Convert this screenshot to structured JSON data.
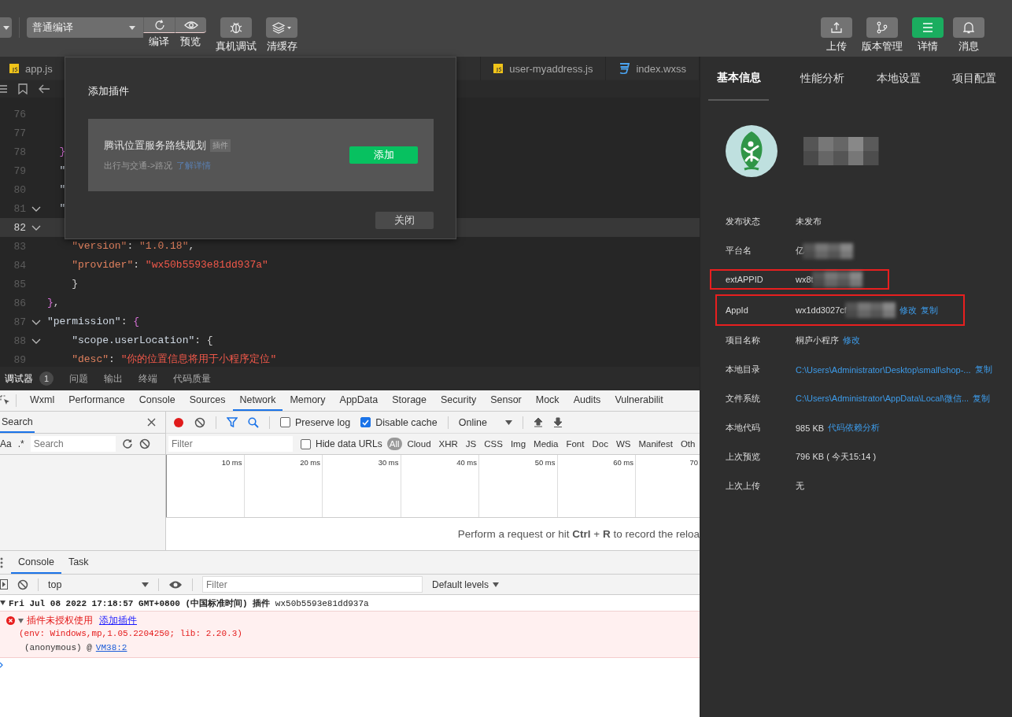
{
  "toolbar": {
    "left": [
      {
        "kind": "dropdown",
        "text": "普通编译"
      },
      {
        "kind": "group-button",
        "label": "编译"
      },
      {
        "kind": "group-button",
        "label": "预览"
      },
      {
        "kind": "button",
        "label": "真机调试"
      },
      {
        "kind": "menu-button",
        "label": "清缓存"
      }
    ],
    "right": [
      {
        "label": "上传",
        "selected": false
      },
      {
        "label": "版本管理",
        "selected": false
      },
      {
        "label": "详情",
        "selected": true
      },
      {
        "label": "消息",
        "selected": false
      }
    ]
  },
  "editor_tabs": [
    {
      "name": "app.js",
      "kind": "js",
      "selected": false
    },
    {
      "name": "user-myaddress.js",
      "kind": "js",
      "selected": false
    },
    {
      "name": "index.wxss",
      "kind": "wxss",
      "selected": false
    }
  ],
  "code": {
    "lines": [
      {
        "number": "76",
        "foldable": false,
        "current": false
      },
      {
        "number": "77",
        "foldable": false,
        "current": false
      },
      {
        "number": "78",
        "foldable": false,
        "current": false,
        "tokens": [
          {
            "kind": "brace",
            "text": "  }"
          }
        ]
      },
      {
        "number": "79",
        "foldable": false,
        "current": false,
        "tokens": [
          {
            "kind": "key",
            "text": "  \""
          }
        ]
      },
      {
        "number": "80",
        "foldable": false,
        "current": false,
        "tokens": [
          {
            "kind": "key",
            "text": "  \""
          }
        ]
      },
      {
        "number": "81",
        "foldable": true,
        "current": false,
        "tokens": [
          {
            "kind": "key",
            "text": "  \""
          }
        ]
      },
      {
        "number": "82",
        "foldable": true,
        "current": true
      },
      {
        "number": "83",
        "foldable": false,
        "current": false,
        "tokens": [
          {
            "kind": "attr",
            "text": "    \"version\""
          },
          {
            "kind": "punct",
            "text": ": "
          },
          {
            "kind": "attr",
            "text": "\"1.0.18\""
          },
          {
            "kind": "punct",
            "text": ","
          }
        ]
      },
      {
        "number": "84",
        "foldable": false,
        "current": false,
        "tokens": [
          {
            "kind": "attr",
            "text": "    \"provider\""
          },
          {
            "kind": "punct",
            "text": ": "
          },
          {
            "kind": "string",
            "text": "\"wx50b5593e81dd937a\""
          }
        ]
      },
      {
        "number": "85",
        "foldable": false,
        "current": false,
        "tokens": [
          {
            "kind": "punct",
            "text": "    }"
          }
        ]
      },
      {
        "number": "86",
        "foldable": false,
        "current": false,
        "tokens": [
          {
            "kind": "brace",
            "text": "}"
          },
          {
            "kind": "punct",
            "text": ","
          }
        ]
      },
      {
        "number": "87",
        "foldable": true,
        "current": false,
        "tokens": [
          {
            "kind": "key",
            "text": "\"permission\""
          },
          {
            "kind": "punct",
            "text": ": "
          },
          {
            "kind": "brace",
            "text": "{"
          }
        ]
      },
      {
        "number": "88",
        "foldable": true,
        "current": false,
        "tokens": [
          {
            "kind": "key",
            "text": "    \"scope.userLocation\""
          },
          {
            "kind": "punct",
            "text": ": {"
          }
        ]
      },
      {
        "number": "89",
        "foldable": false,
        "current": false,
        "tokens": [
          {
            "kind": "attr",
            "text": "    \"desc\""
          },
          {
            "kind": "punct",
            "text": ": "
          },
          {
            "kind": "string",
            "text": "\"你的位置信息将用于小程序定位\""
          }
        ]
      }
    ]
  },
  "dialog": {
    "title": "添加插件",
    "plugin": {
      "name": "腾讯位置服务路线规划",
      "tag": "插件",
      "category": "出行与交通->路况",
      "link": "了解详情",
      "action": "添加"
    },
    "close": "关闭"
  },
  "details": {
    "tabs": [
      {
        "label": "基本信息",
        "selected": true
      },
      {
        "label": "性能分析",
        "selected": false
      },
      {
        "label": "本地设置",
        "selected": false
      },
      {
        "label": "项目配置",
        "selected": false
      }
    ],
    "name_redacted": true,
    "rows": [
      {
        "label": "发布状态",
        "value": "未发布",
        "link": false,
        "redacted": false,
        "highlighted": false,
        "actions": []
      },
      {
        "label": "平台名",
        "value": "亿",
        "link": false,
        "redacted": true,
        "highlighted": false,
        "actions": []
      },
      {
        "label": "extAPPID",
        "value": "wx8t",
        "link": false,
        "redacted": true,
        "highlighted": true,
        "actions": []
      },
      {
        "label": "AppId",
        "value": "wx1dd3027cf",
        "link": false,
        "redacted": true,
        "highlighted": true,
        "actions": [
          "修改",
          "复制"
        ]
      },
      {
        "label": "项目名称",
        "value": "桐庐小程序",
        "link": false,
        "redacted": false,
        "highlighted": false,
        "actions": [
          "修改"
        ]
      },
      {
        "label": "本地目录",
        "value": "C:\\Users\\Administrator\\Desktop\\small\\shop-...",
        "link": true,
        "redacted": false,
        "highlighted": false,
        "actions": [
          "复制"
        ]
      },
      {
        "label": "文件系统",
        "value": "C:\\Users\\Administrator\\AppData\\Local\\微信...",
        "link": true,
        "redacted": false,
        "highlighted": false,
        "actions": [
          "复制"
        ]
      },
      {
        "label": "本地代码",
        "value": "985 KB",
        "link": false,
        "redacted": false,
        "highlighted": false,
        "actions": [
          "代码依赖分析"
        ]
      },
      {
        "label": "上次预览",
        "value": "796 KB ( 今天15:14 )",
        "link": false,
        "redacted": false,
        "highlighted": false,
        "actions": []
      },
      {
        "label": "上次上传",
        "value": "无",
        "link": false,
        "redacted": false,
        "highlighted": false,
        "actions": []
      }
    ]
  },
  "devtools": {
    "tabs": [
      {
        "label": "调试器",
        "badge": "1",
        "selected": true
      },
      {
        "label": "问题",
        "selected": false
      },
      {
        "label": "输出",
        "selected": false
      },
      {
        "label": "终端",
        "selected": false
      },
      {
        "label": "代码质量",
        "selected": false
      }
    ],
    "panels": [
      {
        "label": "Wxml",
        "selected": false
      },
      {
        "label": "Performance",
        "selected": false
      },
      {
        "label": "Console",
        "selected": false
      },
      {
        "label": "Sources",
        "selected": false
      },
      {
        "label": "Network",
        "selected": true
      },
      {
        "label": "Memory",
        "selected": false
      },
      {
        "label": "AppData",
        "selected": false
      },
      {
        "label": "Storage",
        "selected": false
      },
      {
        "label": "Security",
        "selected": false
      },
      {
        "label": "Sensor",
        "selected": false
      },
      {
        "label": "Mock",
        "selected": false
      },
      {
        "label": "Audits",
        "selected": false
      },
      {
        "label": "Vulnerabilit",
        "selected": false
      }
    ],
    "search": {
      "title": "Search",
      "case_toggle": "Aa",
      "regex_toggle": ".*",
      "placeholder": "Search"
    },
    "network": {
      "preserve_log": {
        "label": "Preserve log",
        "checked": false
      },
      "disable_cache": {
        "label": "Disable cache",
        "checked": true
      },
      "throttling": "Online",
      "filter_placeholder": "Filter",
      "hide_data_urls": {
        "label": "Hide data URLs",
        "checked": false
      },
      "types": [
        {
          "label": "All",
          "selected": true
        },
        {
          "label": "Cloud",
          "selected": false
        },
        {
          "label": "XHR",
          "selected": false
        },
        {
          "label": "JS",
          "selected": false
        },
        {
          "label": "CSS",
          "selected": false
        },
        {
          "label": "Img",
          "selected": false
        },
        {
          "label": "Media",
          "selected": false
        },
        {
          "label": "Font",
          "selected": false
        },
        {
          "label": "Doc",
          "selected": false
        },
        {
          "label": "WS",
          "selected": false
        },
        {
          "label": "Manifest",
          "selected": false
        },
        {
          "label": "Oth",
          "selected": false
        }
      ],
      "ticks": [
        "10 ms",
        "20 ms",
        "30 ms",
        "40 ms",
        "50 ms",
        "60 ms",
        "70"
      ],
      "empty_message": "Perform a request or hit **Ctrl** + **R** to record the reloa"
    },
    "drawer": {
      "tabs": [
        {
          "label": "Console",
          "selected": true
        },
        {
          "label": "Task",
          "selected": false
        }
      ],
      "context": "top",
      "filter_placeholder": "Filter",
      "levels": "Default levels",
      "log": {
        "group": "**Fri Jul 08 2022 17:18:57 GMT+0800 (中国标准时间) 插件** wx50b5593e81dd937a",
        "error": "插件未授权使用",
        "error_link": "添加插件",
        "env": "(env: Windows,mp,1.05.2204250; lib: 2.20.3)",
        "stack": "(anonymous) @",
        "stack_link": "VM38:2"
      }
    }
  }
}
